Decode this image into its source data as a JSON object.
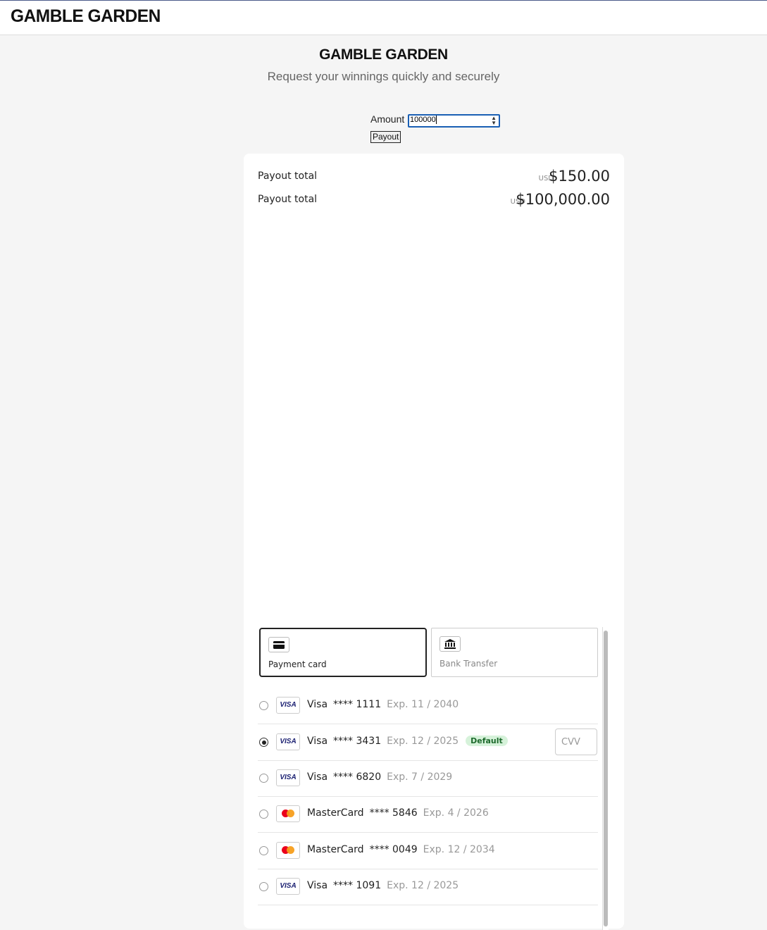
{
  "header": {
    "logo": "GAMBLE GARDEN"
  },
  "hero": {
    "logo": "GAMBLE GARDEN",
    "tagline": "Request your winnings quickly and securely"
  },
  "form": {
    "amount_label": "Amount",
    "amount_value": "100000",
    "payout_button": "Payout"
  },
  "totals": [
    {
      "label": "Payout total",
      "currency": "USD",
      "value": "$150.00"
    },
    {
      "label": "Payout total",
      "currency": "USD",
      "value": "$100,000.00"
    }
  ],
  "methods": [
    {
      "label": "Payment card",
      "icon": "credit-card-icon",
      "selected": true
    },
    {
      "label": "Bank Transfer",
      "icon": "bank-icon",
      "selected": false
    }
  ],
  "cards": [
    {
      "brand": "Visa",
      "logo": "VISA",
      "number": "**** 1111",
      "exp": "Exp. 11 / 2040",
      "selected": false
    },
    {
      "brand": "Visa",
      "logo": "VISA",
      "number": "**** 3431",
      "exp": "Exp. 12 / 2025",
      "selected": true,
      "badge": "Default",
      "cvv_placeholder": "CVV"
    },
    {
      "brand": "Visa",
      "logo": "VISA",
      "number": "**** 6820",
      "exp": "Exp. 7 / 2029",
      "selected": false
    },
    {
      "brand": "MasterCard",
      "logo": "mastercard",
      "number": "**** 5846",
      "exp": "Exp. 4 / 2026",
      "selected": false
    },
    {
      "brand": "MasterCard",
      "logo": "mastercard",
      "number": "**** 0049",
      "exp": "Exp. 12 / 2034",
      "selected": false
    },
    {
      "brand": "Visa",
      "logo": "VISA",
      "number": "**** 1091",
      "exp": "Exp. 12 / 2025",
      "selected": false
    }
  ],
  "colors": {
    "visa": "#1a1f71",
    "badge_bg": "#d6f2da",
    "badge_text": "#1e6b2d",
    "input_focus": "#1a5fb4"
  }
}
